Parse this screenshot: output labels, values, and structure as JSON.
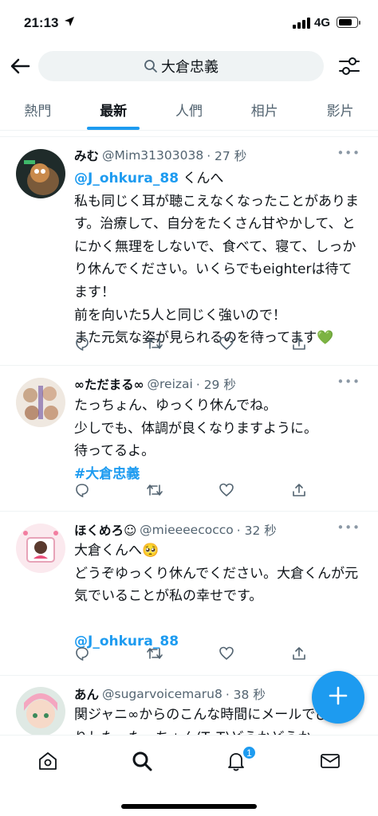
{
  "status": {
    "time": "21:13",
    "network": "4G"
  },
  "search": {
    "query": "大倉忠義"
  },
  "tabs": [
    {
      "label": "熱門",
      "active": false
    },
    {
      "label": "最新",
      "active": true
    },
    {
      "label": "人們",
      "active": false
    },
    {
      "label": "相片",
      "active": false
    },
    {
      "label": "影片",
      "active": false
    }
  ],
  "tweets": [
    {
      "name": "みむ",
      "handle": "@Mim31303038",
      "time": "· 27 秒",
      "mention": "@J_ohkura_88",
      "text_after_mention": " くんへ",
      "text": "私も同じく耳が聴こえなくなったことがあります。治療して、自分をたくさん甘やかして、とにかく無理をしないで、食べて、寝て、しっかり休んでください。いくらでもeighterは待てます！\n前を向いた5人と同じく強いので！\nまた元気な姿が見られるのを待ってます💚"
    },
    {
      "name": "∞ただまる∞",
      "handle": "@reizai",
      "time": "· 29 秒",
      "text": "たっちょん、ゆっくり休んでね。\n少しでも、体調が良くなりますように。\n待ってるよ。",
      "hashtag": "#大倉忠義"
    },
    {
      "name": "ほくめろ☺",
      "handle": "@mieeeecocco",
      "time": "· 32 秒",
      "text": "大倉くんへ🥺\nどうぞゆっくり休んでください。大倉くんが元気でいることが私の幸せです。",
      "mention": "@J_ohkura_88"
    },
    {
      "name": "あん",
      "handle": "@sugarvoicemaru8",
      "time": "· 38 秒",
      "text": "関ジャニ∞からのこんな時間にメールでびっくりした。たっちょん(T_T)どうかどうか"
    }
  ],
  "more_label": "•••",
  "notifications_badge": "1",
  "icons": {
    "back": "back-arrow-icon",
    "search": "search-icon",
    "filter": "filter-settings-icon",
    "reply": "reply-icon",
    "retweet": "retweet-icon",
    "like": "heart-icon",
    "share": "share-icon",
    "compose": "compose-plus-icon",
    "home": "home-icon",
    "explore": "search-icon",
    "notifications": "bell-icon",
    "messages": "mail-icon"
  },
  "colors": {
    "accent": "#1d9bf0",
    "text": "#0f1419",
    "secondary": "#536471"
  }
}
